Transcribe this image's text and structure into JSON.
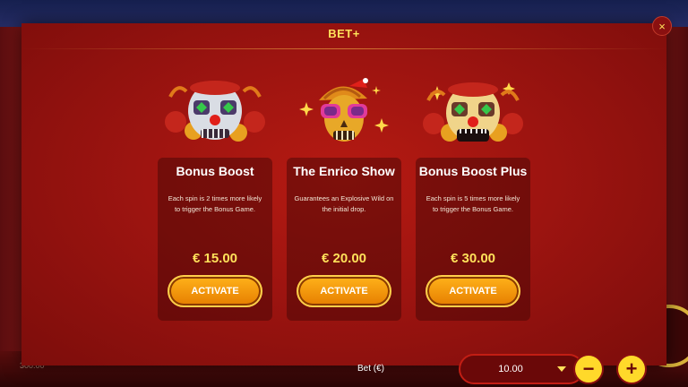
{
  "background": {
    "balance_text": "300.00"
  },
  "modal": {
    "title": "BET+",
    "close_label": "×"
  },
  "cards": [
    {
      "name": "Bonus Boost",
      "description": "Each spin is 2 times more likely to trigger the Bonus Game.",
      "price": "€ 15.00",
      "button_label": "ACTIVATE",
      "icon": "clown-skull-icon"
    },
    {
      "name": "The Enrico Show",
      "description": "Guarantees an Explosive Wild on the initial drop.",
      "price": "€ 20.00",
      "button_label": "ACTIVATE",
      "icon": "party-skull-icon"
    },
    {
      "name": "Bonus Boost Plus",
      "description": "Each spin is 5 times more likely to trigger the Bonus Game.",
      "price": "€ 30.00",
      "button_label": "ACTIVATE",
      "icon": "clown-skull-gold-icon"
    }
  ],
  "bet": {
    "label": "Bet (€)",
    "value": "10.00",
    "minus_label": "−",
    "plus_label": "+"
  },
  "colors": {
    "accent": "#ffe15a",
    "button": "#f39c12",
    "panel": "#9d1410"
  }
}
